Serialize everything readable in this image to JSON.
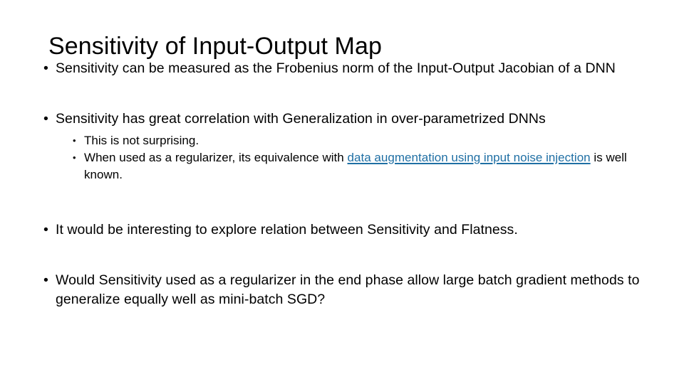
{
  "slide": {
    "title": "Sensitivity of Input-Output Map",
    "background_color": "#ffffff",
    "text_color": "#000000",
    "hyperlink_color": "#1F6FA4",
    "bullet_glyph": "•"
  },
  "bullets": [
    {
      "level": 1,
      "text": "Sensitivity can be measured as the Frobenius norm of the Input-Output Jacobian of a DNN"
    },
    {
      "level": 1,
      "text": "Sensitivity has great correlation with Generalization in over-parametrized DNNs"
    },
    {
      "level": 2,
      "text": "This is not surprising."
    },
    {
      "level": 2,
      "text_before_link": "When used as a regularizer, its equivalence with ",
      "link_text": "data augmentation using input noise injection",
      "text_after_link": " is well known."
    },
    {
      "level": 1,
      "text": "It would be interesting to explore relation between Sensitivity and Flatness."
    },
    {
      "level": 1,
      "text": "Would Sensitivity used as a regularizer in the end phase allow large batch gradient methods to generalize equally well as mini-batch SGD?"
    }
  ]
}
